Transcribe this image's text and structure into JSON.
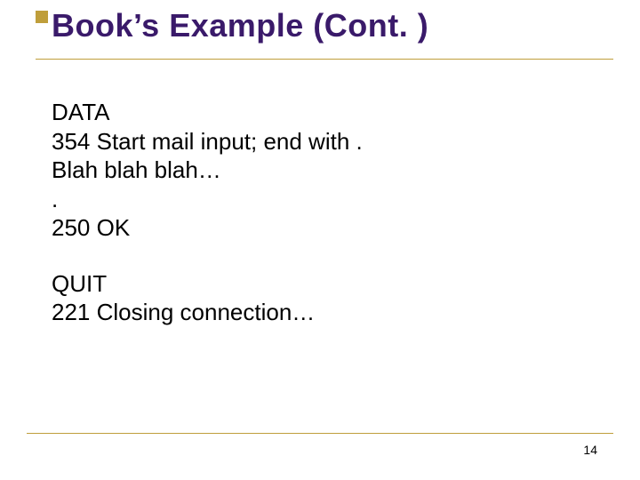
{
  "title": "Book’s Example (Cont. )",
  "lines": {
    "l1": "DATA",
    "l2": "354 Start mail input; end with .",
    "l3": "Blah blah blah…",
    "l4": ".",
    "l5": "250 OK",
    "l6": "QUIT",
    "l7": "221 Closing connection…"
  },
  "page_number": "14"
}
